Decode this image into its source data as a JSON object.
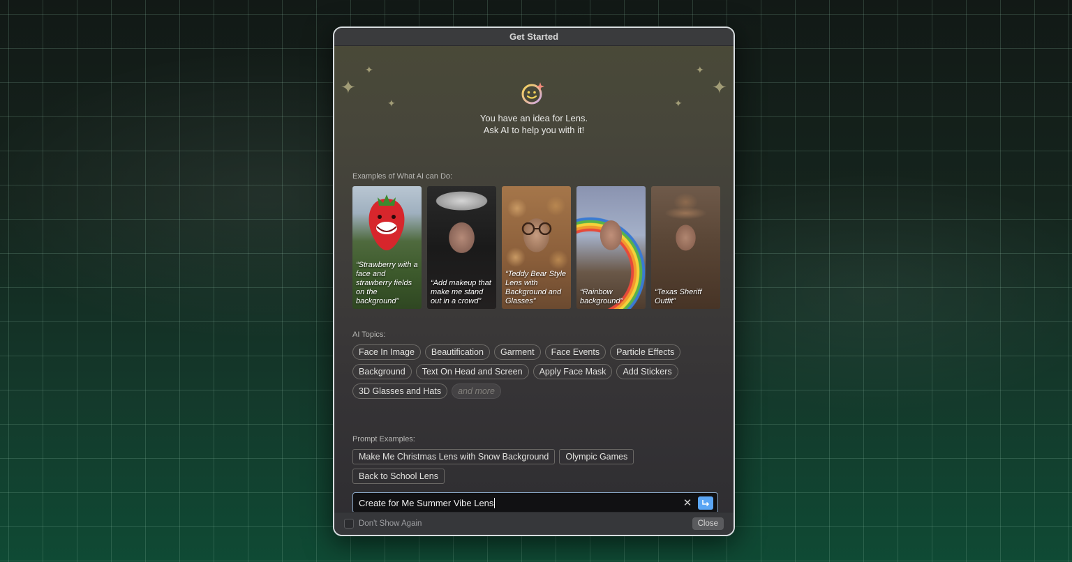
{
  "window": {
    "title": "Get Started"
  },
  "hero": {
    "line1": "You have an idea for Lens.",
    "line2": "Ask AI to help you with it!"
  },
  "examples": {
    "label": "Examples of What AI can Do:",
    "cards": [
      {
        "caption": "“Strawberry with a face and strawberry fields on the background”"
      },
      {
        "caption": "“Add makeup that make me stand out in a crowd”"
      },
      {
        "caption": "“Teddy Bear Style Lens with Background and Glasses”"
      },
      {
        "caption": "“Rainbow background”"
      },
      {
        "caption": "“Texas Sheriff Outfit”"
      }
    ]
  },
  "topics": {
    "label": "AI Topics:",
    "items": [
      "Face In Image",
      "Beautification",
      "Garment",
      "Face Events",
      "Particle Effects",
      "Background",
      "Text On Head and Screen",
      "Apply Face Mask",
      "Add Stickers",
      "3D Glasses and Hats"
    ],
    "more": "and more"
  },
  "prompts": {
    "label": "Prompt Examples:",
    "items": [
      "Make Me Christmas Lens with Snow Background",
      "Olympic Games",
      "Back to School Lens"
    ]
  },
  "input": {
    "value": "Create for Me Summer Vibe Lens"
  },
  "footer": {
    "dont_show": "Don't Show Again",
    "close": "Close"
  },
  "colors": {
    "accent": "#5ba6f5",
    "input_border": "#8aa8c7"
  }
}
